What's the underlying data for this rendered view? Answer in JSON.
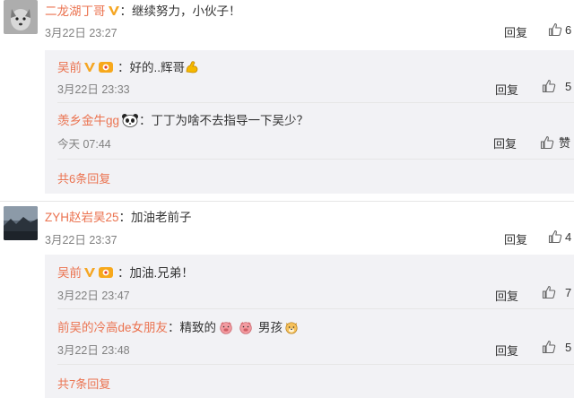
{
  "comments": [
    {
      "user": "二龙湖丁哥",
      "text": "：继续努力，小伙子！",
      "time": "3月22日 23:27",
      "reply_label": "回复",
      "like_count": "6",
      "replies": [
        {
          "user": "吴前",
          "text": "：好的..辉哥",
          "time": "3月22日 23:33",
          "reply_label": "回复",
          "like_count": "5"
        },
        {
          "user": "羡乡金牛gg",
          "text": "：丁丁为啥不去指导一下吴少？",
          "time": "今天 07:44",
          "reply_label": "回复",
          "like_label": "赞"
        }
      ],
      "more_label": "共6条回复"
    },
    {
      "user": "ZYH赵岩昊25",
      "text": "：加油老前子",
      "time": "3月22日 23:37",
      "reply_label": "回复",
      "like_count": "4",
      "replies": [
        {
          "user": "吴前",
          "text": "：加油.兄弟！",
          "time": "3月22日 23:47",
          "reply_label": "回复",
          "like_count": "7"
        },
        {
          "user": "前吴的冷高de女朋友",
          "text_a": "：精致的",
          "text_b": "男孩",
          "time": "3月22日 23:48",
          "reply_label": "回复",
          "like_count": "5"
        }
      ],
      "more_label": "共7条回复"
    }
  ],
  "colors": {
    "name": "#eb7350",
    "badge": "#f5a623",
    "reply_bg": "#f2f2f5"
  },
  "icons": [
    "verified-v-icon",
    "member-badge-icon",
    "flex-arm-emoji",
    "panda-emoji",
    "pig-emoji",
    "dog-emoji",
    "thumb-up-icon"
  ]
}
